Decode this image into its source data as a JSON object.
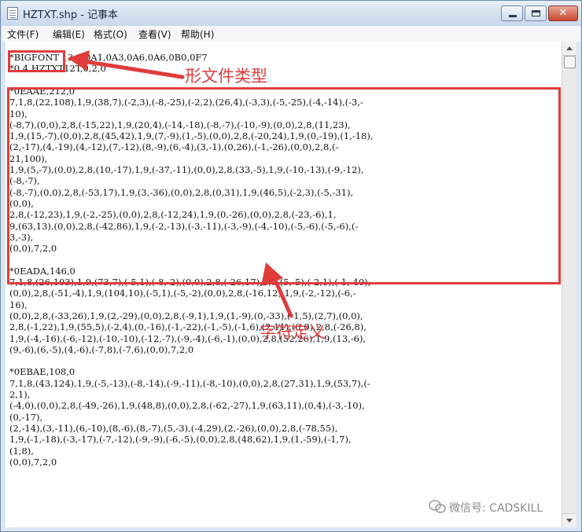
{
  "window": {
    "title": "HZTXT.shp - 记事本",
    "minimize_glyph": "",
    "close_glyph": "✕"
  },
  "menu": [
    "文件(F)",
    "编辑(E)",
    "格式(O)",
    "查看(V)",
    "帮助(H)"
  ],
  "editor_lines": [
    "*BIGFONT 13,3,0A1,0A3,0A6,0A6,0B0,0F7",
    "*0,4,HZTXT12T,0,2,0",
    "",
    "*0EAAE,212,0",
    "7,1,8,(22,108),1,9,(38,7),(-2,3),(-8,-25),(-2,2),(26,4),(-3,3),(-5,-25),(-4,-14),(-3,-",
    "10),",
    "(-8,7),(0,0),2,8,(-15,22),1,9,(20,4),(-14,-18),(-8,-7),(-10,-9),(0,0),2,8,(11,23),",
    "1,9,(15,-7),(0,0),2,8,(45,42),1,9,(7,-9),(1,-5),(0,0),2,8,(-20,24),1,9,(0,-19),(1,-18),",
    "(2,-17),(4,-19),(4,-12),(7,-12),(8,-9),(6,-4),(3,-1),(0,26),(-1,-26),(0,0),2,8,(-",
    "21,100),",
    "1,9,(5,-7),(0,0),2,8,(10,-17),1,9,(-37,-11),(0,0),2,8,(33,-5),1,9,(-10,-13),(-9,-12),",
    "(-8,-7),",
    "(-8,-7),(0,0),2,8,(-53,17),1,9,(3,-36),(0,0),2,8,(0,31),1,9,(46,5),(-2,3),(-5,-31),",
    "(0,0),",
    "2,8,(-12,23),1,9,(-2,-25),(0,0),2,8,(-12,24),1,9,(0,-26),(0,0),2,8,(-23,-6),1,",
    "9,(63,13),(0,0),2,8,(-42,86),1,9,(-2,-13),(-3,-11),(-3,-9),(-4,-10),(-5,-6),(-5,-6),(-",
    "3,-3),",
    "(0,0),7,2,0",
    "",
    "*0EADA,146,0",
    "7,1,8,(26,103),1,9,(73,7),(-5,1),(-8,-2),(0,0),2,8,(-26,17),1,9,(5,-5),(-2,1),(-1,-40),",
    "(0,0),2,8,(-51,-4),1,9,(104,10),(-5,1),(-5,-2),(0,0),2,8,(-16,12),1,9,(-2,-12),(-6,-",
    "16),",
    "(0,0),2,8,(-33,26),1,9,(2,-29),(0,0),2,8,(-9,1),1,9,(1,-9),(0,-33),(-1,5),(2,7),(0,0),",
    "2,8,(-1,22),1,9,(55,5),(-2,4),(0,-16),(-1,-22),(-1,-5),(-1,6),(2,11),(0,0),2,8,(-26,8),",
    "1,9,(-4,-16),(-6,-12),(-10,-10),(-12,-7),(-9,-4),(-6,-1),(0,0),2,8,(52,26),1,9,(13,-6),",
    "(9,-6),(6,-5),(4,-6),(-7,8),(-7,6),(0,0),7,2,0",
    "",
    "*0EBAE,108,0",
    "7,1,8,(43,124),1,9,(-5,-13),(-8,-14),(-9,-11),(-8,-10),(0,0),2,8,(27,31),1,9,(53,7),(-",
    "2,1),",
    "(-4,0),(0,0),2,8,(-49,-26),1,9,(48,8),(0,0),2,8,(-62,-27),1,9,(63,11),(0,4),(-3,-10),",
    "(0,-17),",
    "(2,-14),(3,-11),(6,-10),(8,-6),(8,-7),(5,-3),(-4,29),(2,-26),(0,0),2,8,(-78,55),",
    "1,9,(-1,-18),(-3,-17),(-7,-12),(-9,-9),(-6,-5),(0,0),2,8,(48,62),1,9,(1,-59),(-1,7),",
    "(1,8),",
    "(0,0),7,2,0"
  ],
  "annotations": {
    "shape_file_type": "形文件类型",
    "char_definition": "字符定义",
    "color": "#e03c3c"
  },
  "watermark": {
    "text": "微信号: CADSKILL",
    "icon": "wechat-icon"
  }
}
